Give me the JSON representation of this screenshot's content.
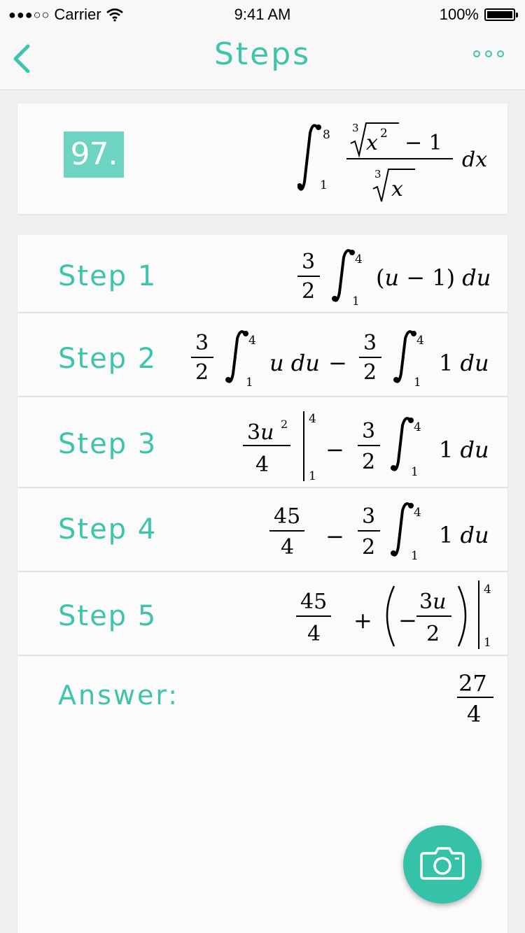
{
  "status_bar": {
    "signal_dots": "●●●○○",
    "carrier": "Carrier",
    "time": "9:41 AM",
    "battery": "100%"
  },
  "nav": {
    "title": "Steps",
    "back_icon": "chevron-left-icon",
    "more_icon": "more-dots-icon"
  },
  "problem": {
    "number": "97.",
    "expression": "∫_1^8 (∛(x²) − 1) / ∛x dx"
  },
  "steps": [
    {
      "label": "Step 1",
      "expression": "3/2 ∫_1^4 (u − 1) du"
    },
    {
      "label": "Step 2",
      "expression": "3/2 ∫_1^4 u du − 3/2 ∫_1^4 1 du"
    },
    {
      "label": "Step 3",
      "expression": "3u²/4 |_1^4 − 3/2 ∫_1^4 1 du"
    },
    {
      "label": "Step 4",
      "expression": "45/4 − 3/2 ∫_1^4 1 du"
    },
    {
      "label": "Step 5",
      "expression": "45/4 + (−3u/2) |_1^4"
    }
  ],
  "answer": {
    "label": "Answer:",
    "numerator": "27",
    "denominator": "4"
  },
  "colors": {
    "accent": "#3ec4aa",
    "badge": "#6dd4c1",
    "camera_button": "#36c2a9"
  },
  "camera_icon": "camera-icon"
}
